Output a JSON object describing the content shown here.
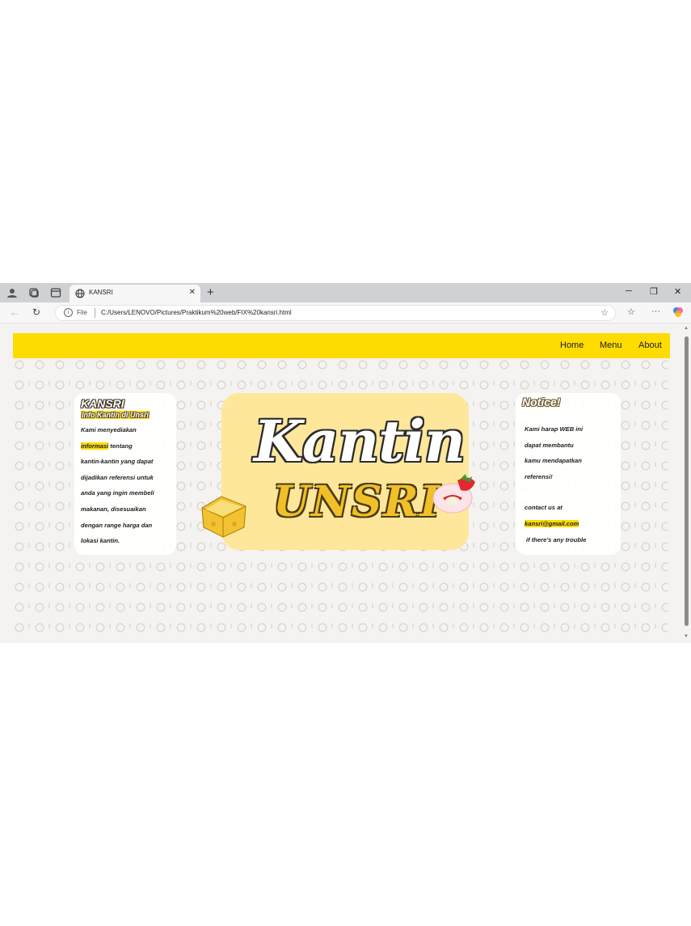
{
  "browser": {
    "tab_title": "KANSRI",
    "url_scheme": "File",
    "url": "C:/Users/LENOVO/Pictures/Praktikum%20web/FIX%20kansri.html"
  },
  "nav": {
    "home": "Home",
    "menu": "Menu",
    "about": "About"
  },
  "left_card": {
    "brand": "KANSRI",
    "subtitle": "Info Kantin di Unsri",
    "line1": "Kami menyediakan",
    "line2_highlight": "informasi",
    "line2_rest": " tentang",
    "line3": "kantin-kantin yang dapat",
    "line4": "dijadikan referensi untuk",
    "line5": "anda yang ingin membeli",
    "line6": "makanan, disesuaikan",
    "line7": "dengan range harga dan",
    "line8": "lokasi kantin."
  },
  "hero": {
    "title": "Kantin",
    "subtitle": "UNSRI"
  },
  "right_card": {
    "heading": "Notice!",
    "line1": "Kami harap WEB ini",
    "line2": "dapat membantu",
    "line3": "kamu mendapatkan",
    "line4": "referensi!",
    "contact_label": "contact us at",
    "email": "kansri@gmail.com",
    "trouble": "if there's any trouble"
  },
  "colors": {
    "accent_yellow": "#ffdc00",
    "hero_bg": "#fee79b",
    "page_bg": "#f4f3f1"
  }
}
